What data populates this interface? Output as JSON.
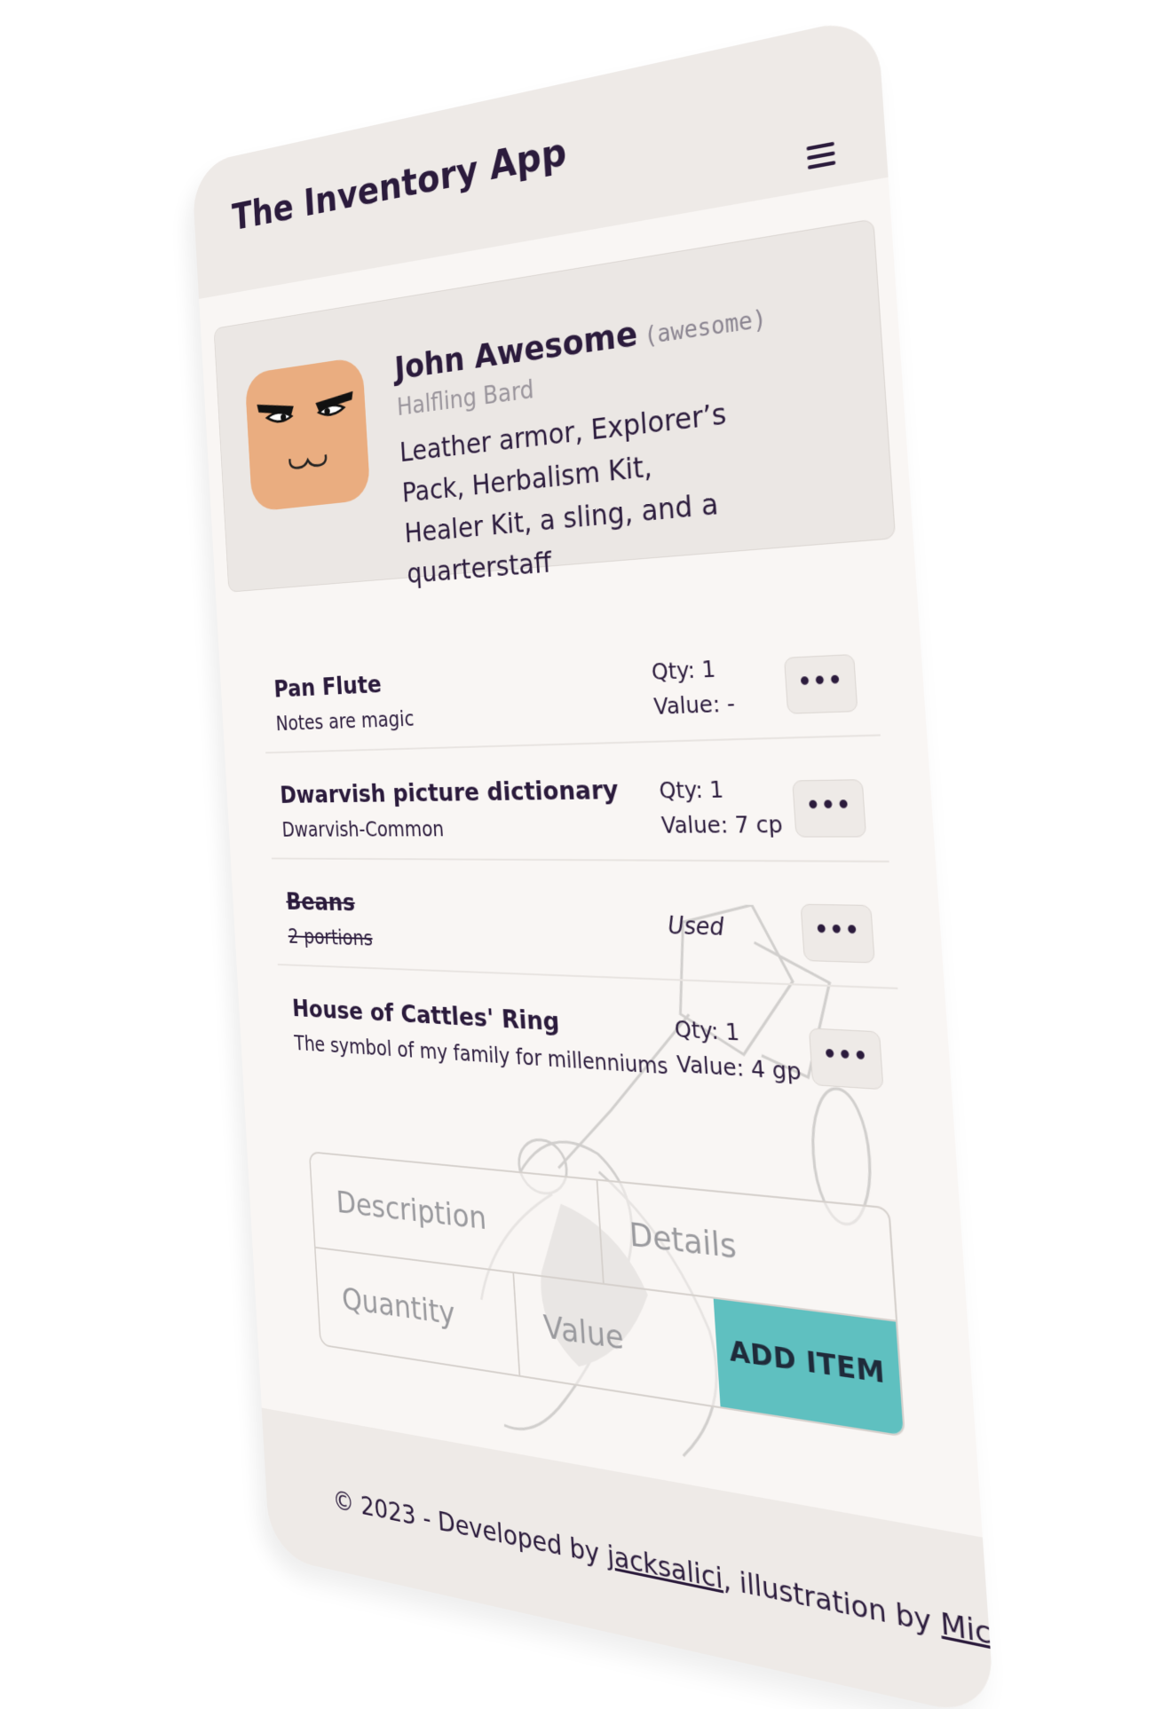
{
  "header": {
    "title": "The Inventory App",
    "menu_icon": "hamburger-menu-icon"
  },
  "character": {
    "name": "John Awesome",
    "handle": "(awesome)",
    "race_class": "Halfling Bard",
    "equipment": "Leather armor, Explorer’s Pack, Herbalism Kit, Healer Kit, a sling, and a quarterstaff",
    "avatar_color": "#eaad80"
  },
  "items": [
    {
      "name": "Pan Flute",
      "description": "Notes are magic",
      "qty": "Qty: 1",
      "value": "Value: -",
      "status": "",
      "used": false,
      "more_label": "•••"
    },
    {
      "name": "Dwarvish picture dictionary",
      "description": "Dwarvish-Common",
      "qty": "Qty: 1",
      "value": "Value: 7 cp",
      "status": "",
      "used": false,
      "more_label": "•••"
    },
    {
      "name": "Beans",
      "description": "2 portions",
      "qty": "",
      "value": "",
      "status": "Used",
      "used": true,
      "more_label": "•••"
    },
    {
      "name": "House of Cattles' Ring",
      "description": "The symbol of my family for millenniums",
      "qty": "Qty: 1",
      "value": "Value: 4 gp",
      "status": "",
      "used": false,
      "more_label": "•••"
    }
  ],
  "form": {
    "description_placeholder": "Description",
    "details_placeholder": "Details",
    "quantity_placeholder": "Quantity",
    "value_placeholder": "Value",
    "submit_label": "ADD ITEM",
    "accent_color": "#5fc0c0"
  },
  "footer": {
    "prefix": "© 2023 - Developed by ",
    "developer": "jacksalici",
    "middle": ", illustration by ",
    "illustrator": "Mich",
    "suffix": "."
  }
}
